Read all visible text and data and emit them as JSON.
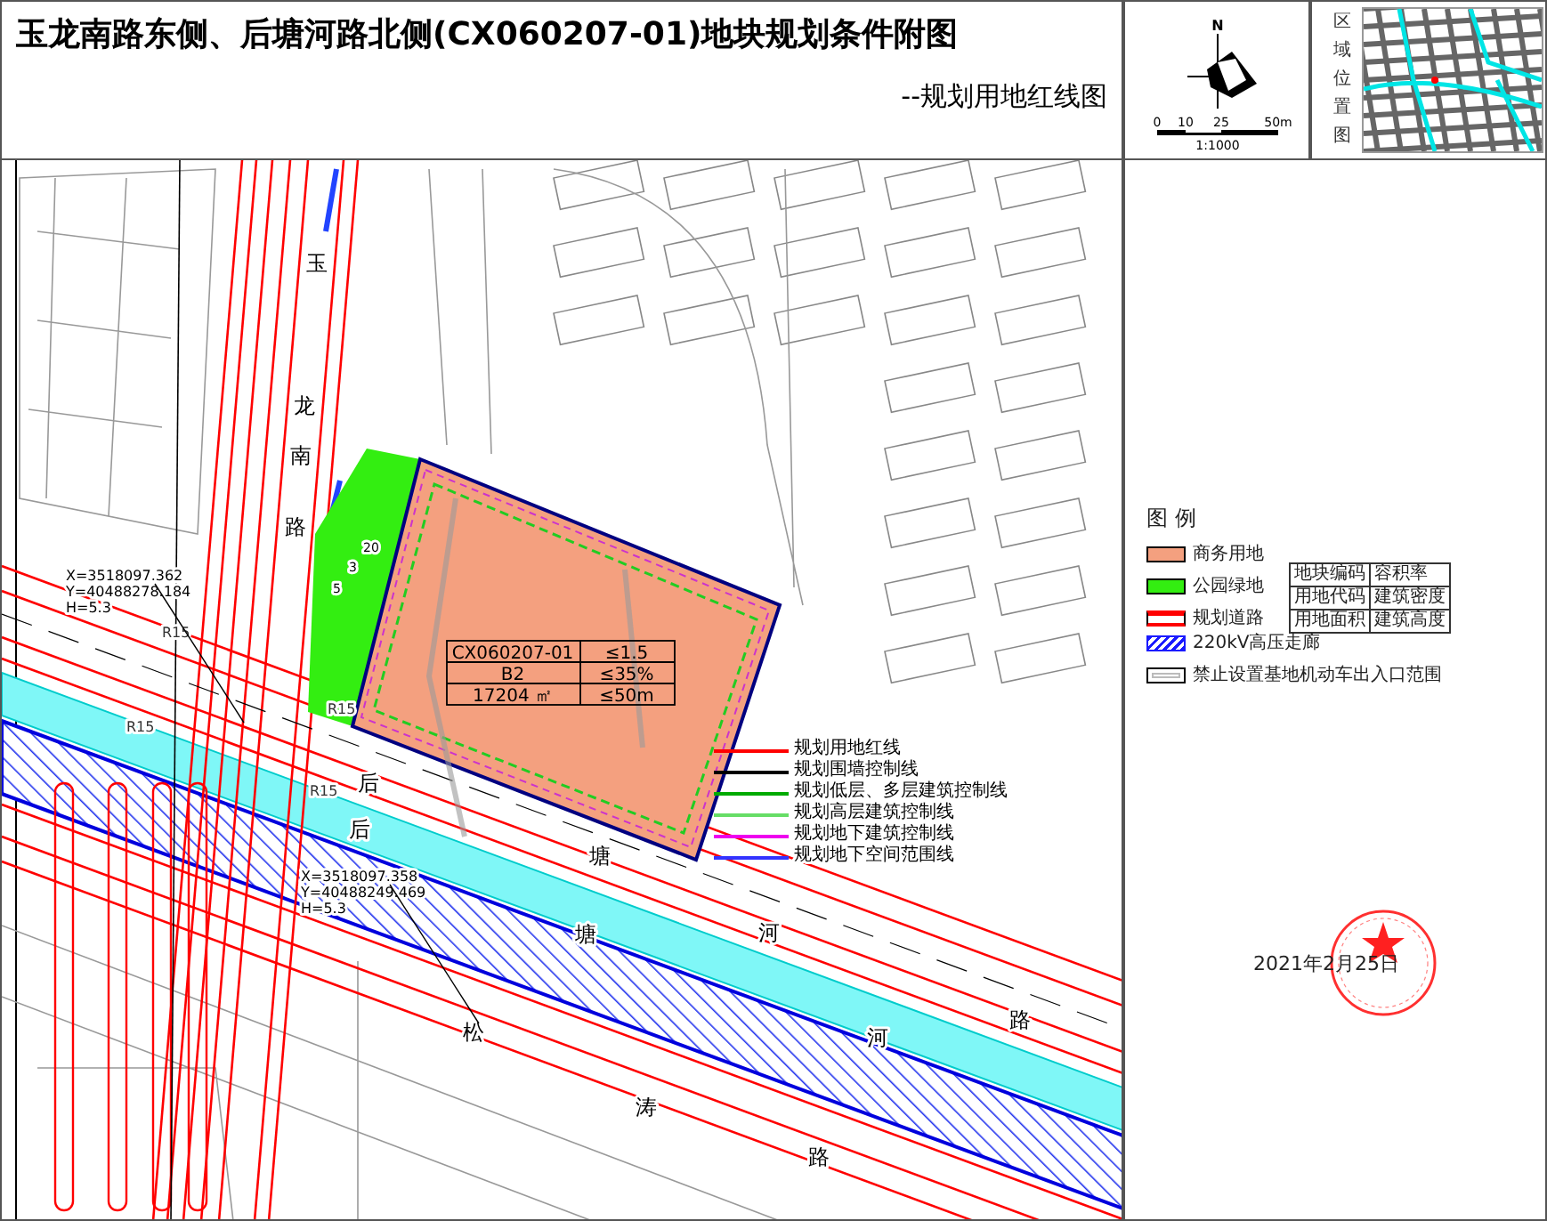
{
  "header": {
    "title": "玉龙南路东侧、后塘河路北侧(CX060207-01)地块规划条件附图",
    "subtitle": "--规划用地红线图"
  },
  "compass": {
    "north": "N",
    "scale_ticks": [
      "0",
      "10",
      "25",
      "50m"
    ],
    "scale_ratio": "1:1000"
  },
  "location_map": {
    "label": "区域位置图"
  },
  "map": {
    "road_labels": [
      {
        "text": "玉"
      },
      {
        "text": "龙"
      },
      {
        "text": "南"
      },
      {
        "text": "路"
      },
      {
        "text": "后"
      },
      {
        "text": "塘"
      },
      {
        "text": "河"
      },
      {
        "text": "路"
      },
      {
        "text": "后"
      },
      {
        "text": "塘"
      },
      {
        "text": "河"
      },
      {
        "text": "松"
      },
      {
        "text": "涛"
      },
      {
        "text": "路"
      }
    ],
    "radius_labels": [
      "R15",
      "R15",
      "R15",
      "R15"
    ],
    "dimension_labels": [
      "20",
      "3",
      "5"
    ],
    "coordinate_labels": [
      {
        "lines": [
          "X=3518097.362",
          "Y=40488278.184",
          "H=5.3"
        ]
      },
      {
        "lines": [
          "X=3518097.358",
          "Y=40488249.469",
          "H=5.3"
        ]
      }
    ],
    "parcel_table": {
      "rows": [
        [
          "CX060207-01",
          "≤1.5"
        ],
        [
          "B2",
          "≤35%"
        ],
        [
          "17204 ㎡",
          "≤50m"
        ]
      ]
    },
    "control_lines": [
      {
        "label": "规划用地红线",
        "color": "#ff0000"
      },
      {
        "label": "规划围墙控制线",
        "color": "#000000"
      },
      {
        "label": "规划低层、多层建筑控制线",
        "color": "#00aa00"
      },
      {
        "label": "规划高层建筑控制线",
        "color": "#66dd66"
      },
      {
        "label": "规划地下建筑控制线",
        "color": "#ee00ee"
      },
      {
        "label": "规划地下空间范围线",
        "color": "#3333ff"
      }
    ]
  },
  "legend": {
    "title": "图 例",
    "items": [
      {
        "kind": "fill",
        "label": "商务用地",
        "color": "#f4a07f"
      },
      {
        "kind": "fill",
        "label": "公园绿地",
        "color": "#33ee11"
      },
      {
        "kind": "road",
        "label": "规划道路",
        "color": "#ff0000"
      },
      {
        "kind": "hatch",
        "label": "220kV高压走廊",
        "color": "#1a1aff"
      },
      {
        "kind": "outline",
        "label": "禁止设置基地机动车出入口范围",
        "color": "#000000"
      }
    ],
    "key_table": [
      [
        "地块编码",
        "容积率"
      ],
      [
        "用地代码",
        "建筑密度"
      ],
      [
        "用地面积",
        "建筑高度"
      ]
    ]
  },
  "approval": {
    "date": "2021年2月25日"
  }
}
